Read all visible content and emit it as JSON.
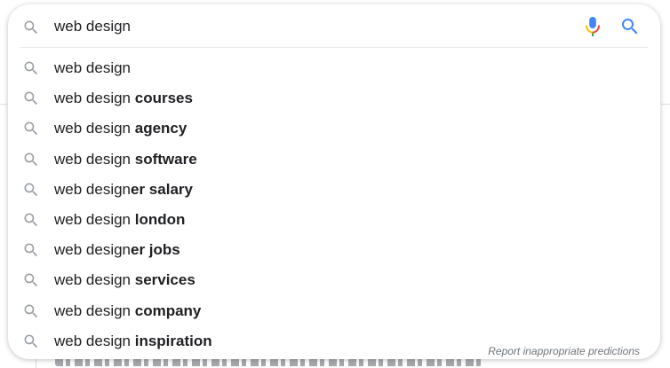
{
  "search": {
    "query": "web design",
    "icons": {
      "leading": "search-icon",
      "voice": "microphone-icon",
      "submit": "search-icon"
    }
  },
  "suggestions": [
    {
      "typed": "web design",
      "completion": ""
    },
    {
      "typed": "web design ",
      "completion": "courses"
    },
    {
      "typed": "web design ",
      "completion": "agency"
    },
    {
      "typed": "web design ",
      "completion": "software"
    },
    {
      "typed": "web design",
      "completion": "er salary"
    },
    {
      "typed": "web design ",
      "completion": "london"
    },
    {
      "typed": "web design",
      "completion": "er jobs"
    },
    {
      "typed": "web design ",
      "completion": "services"
    },
    {
      "typed": "web design ",
      "completion": "company"
    },
    {
      "typed": "web design ",
      "completion": "inspiration"
    }
  ],
  "footer": {
    "report_label": "Report inappropriate predictions"
  },
  "colors": {
    "icon_gray": "#9aa0a6",
    "text": "#202124",
    "report_text": "#70757a",
    "google_blue": "#4285f4",
    "google_red": "#ea4335",
    "google_yellow": "#fbbc04",
    "google_green": "#34a853"
  }
}
